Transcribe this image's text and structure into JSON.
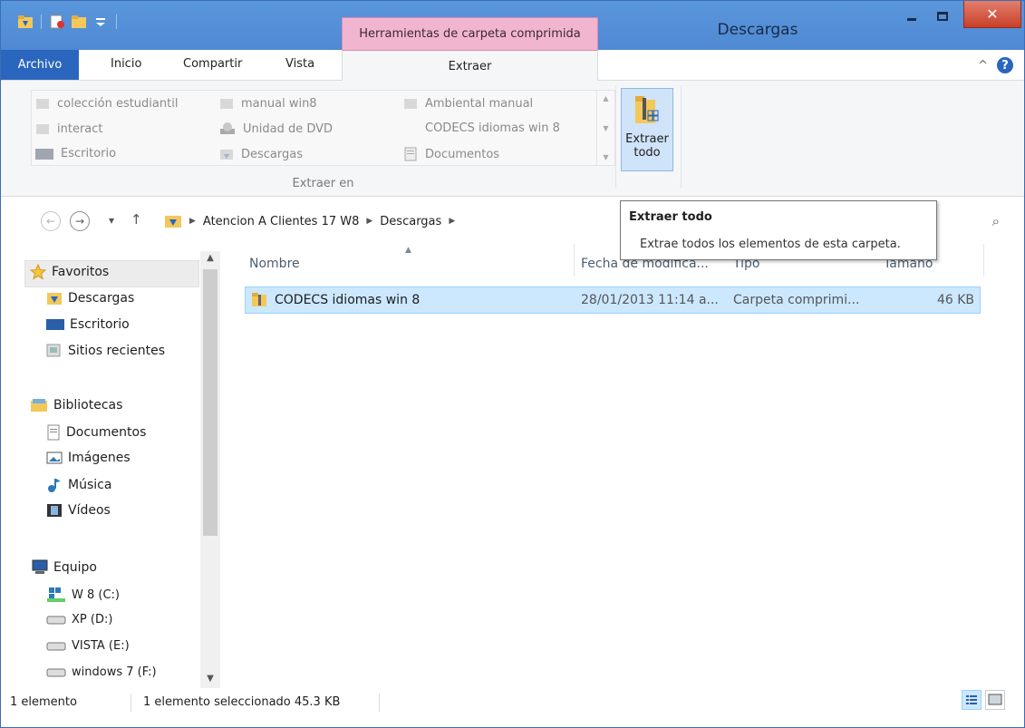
{
  "titlebar": {
    "context_tab": "Herramientas de carpeta comprimida",
    "window_title": "Descargas",
    "close_glyph": "✕"
  },
  "ribbon_tabs": {
    "archivo": "Archivo",
    "inicio": "Inicio",
    "compartir": "Compartir",
    "vista": "Vista",
    "extraer": "Extraer",
    "help": "?",
    "collapse": "^"
  },
  "ribbon": {
    "gallery": [
      {
        "label": "colección estudiantil",
        "icon": "folder-icon"
      },
      {
        "label": "interact",
        "icon": "folder-icon"
      },
      {
        "label": "Escritorio",
        "icon": "desktop-icon"
      },
      {
        "label": "manual win8",
        "icon": "folder-icon"
      },
      {
        "label": "Unidad de DVD",
        "icon": "dvd-drive-icon"
      },
      {
        "label": "Descargas",
        "icon": "downloads-folder-icon"
      },
      {
        "label": "Ambiental manual",
        "icon": "folder-icon"
      },
      {
        "label": "CODECS idiomas win 8",
        "icon": "zip-folder-icon"
      },
      {
        "label": "Documentos",
        "icon": "documents-icon"
      }
    ],
    "group_label": "Extraer en",
    "extract_all_line1": "Extraer",
    "extract_all_line2": "todo"
  },
  "navbar": {
    "back": "←",
    "forward": "→",
    "recent": "▾",
    "up": "↑",
    "crumbs": [
      "Atencion A Clientes 17  W8",
      "Descargas"
    ],
    "search_icon": "⌕"
  },
  "tooltip": {
    "title": "Extraer todo",
    "body": "Extrae todos los elementos de esta carpeta."
  },
  "navpane": {
    "favoritos": "Favoritos",
    "fav_items": [
      "Descargas",
      "Escritorio",
      "Sitios recientes"
    ],
    "bibliotecas": "Bibliotecas",
    "lib_items": [
      "Documentos",
      "Imágenes",
      "Música",
      "Vídeos"
    ],
    "equipo": "Equipo",
    "drives": [
      "W 8 (C:)",
      "XP (D:)",
      "VISTA (E:)",
      "windows 7 (F:)"
    ]
  },
  "columns": {
    "name": "Nombre",
    "date": "Fecha de modifica...",
    "type": "Tipo",
    "size": "Tamaño"
  },
  "files": [
    {
      "name": "CODECS idiomas win 8",
      "date": "28/01/2013 11:14 a...",
      "type": "Carpeta comprimi...",
      "size": "46 KB"
    }
  ],
  "status": {
    "count": "1 elemento",
    "selection": "1 elemento seleccionado  45.3 KB"
  },
  "colors": {
    "accent": "#2b66be",
    "context_tab": "#f2b5d0",
    "selection": "#cce8ff",
    "close": "#c8402a"
  }
}
